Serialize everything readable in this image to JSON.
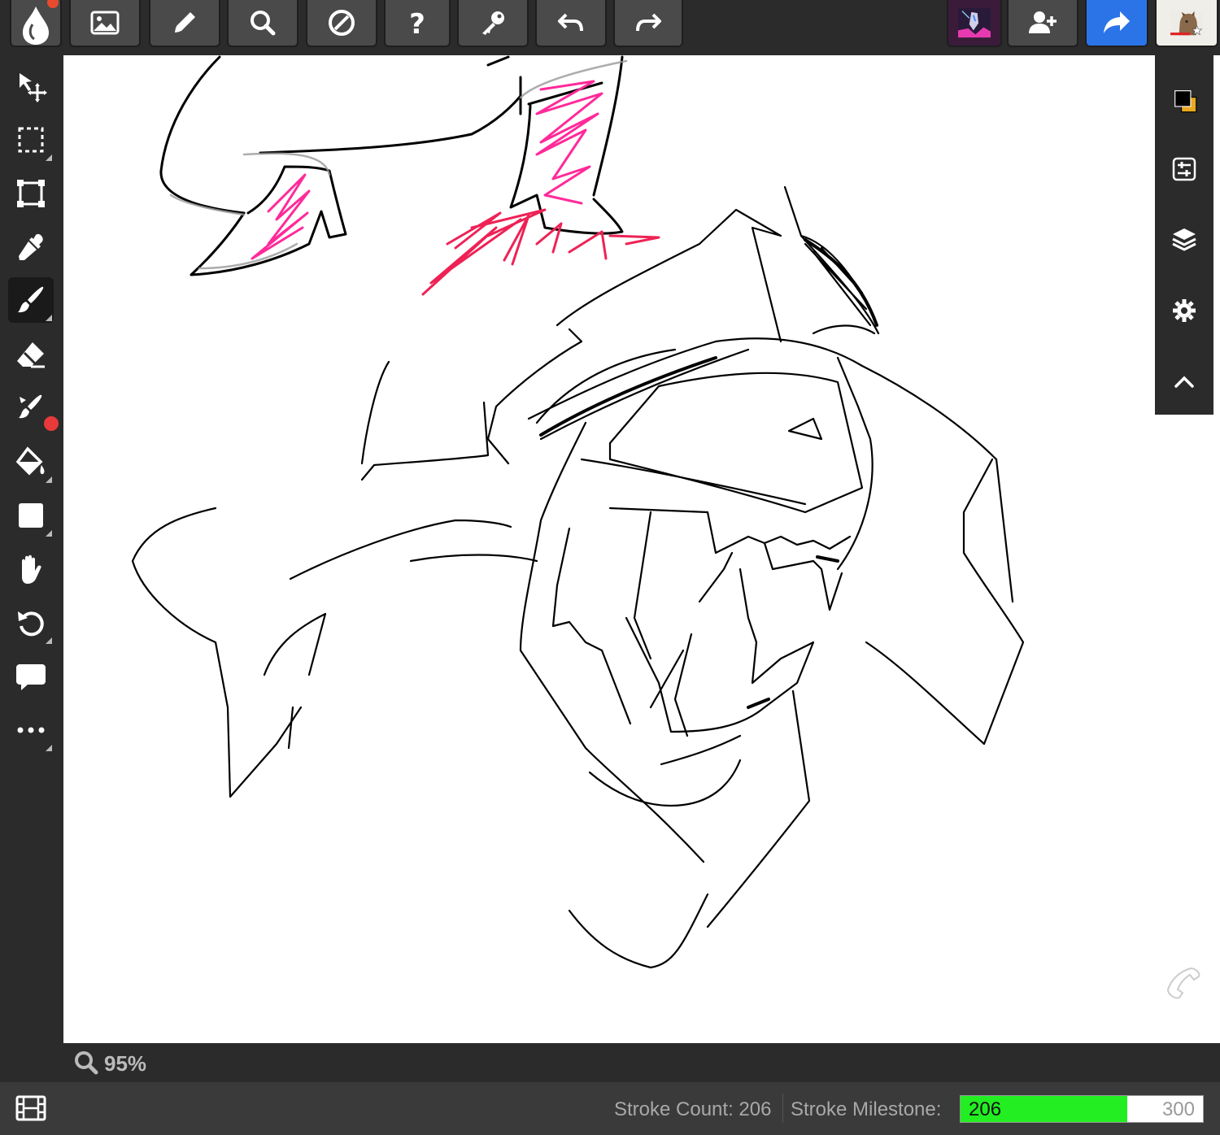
{
  "toolbar": {
    "buttons": [
      {
        "name": "image-button",
        "icon": "image-icon"
      },
      {
        "name": "pencil-button",
        "icon": "pencil-icon"
      },
      {
        "name": "search-button",
        "icon": "search-icon"
      },
      {
        "name": "no-button",
        "icon": "prohibited-icon"
      },
      {
        "name": "help-button",
        "icon": "question-icon"
      },
      {
        "name": "key-button",
        "icon": "key-icon"
      },
      {
        "name": "undo-button",
        "icon": "undo-icon"
      },
      {
        "name": "redo-button",
        "icon": "redo-icon"
      }
    ],
    "right": [
      "artwork-thumbnail",
      "add-user-button",
      "share-button",
      "user-avatar"
    ],
    "share_color": "#2a74e8"
  },
  "tools": [
    {
      "name": "move-tool",
      "icon": "move-icon"
    },
    {
      "name": "select-tool",
      "icon": "select-icon"
    },
    {
      "name": "transform-tool",
      "icon": "transform-icon"
    },
    {
      "name": "eyedropper-tool",
      "icon": "eyedropper-icon"
    },
    {
      "name": "brush-tool",
      "icon": "brush-icon",
      "active": true
    },
    {
      "name": "eraser-tool",
      "icon": "eraser-icon"
    },
    {
      "name": "brush-settings-tool",
      "icon": "brush-dot-icon"
    },
    {
      "name": "fill-tool",
      "icon": "paint-bucket-icon"
    },
    {
      "name": "shape-tool",
      "icon": "square-icon"
    },
    {
      "name": "hand-tool",
      "icon": "hand-icon"
    },
    {
      "name": "rotate-tool",
      "icon": "rotate-icon"
    },
    {
      "name": "comment-tool",
      "icon": "comment-icon"
    },
    {
      "name": "more-tool",
      "icon": "ellipsis-icon"
    }
  ],
  "colors": {
    "primary": "#000000",
    "secondary": "#e8a820",
    "brush_pink": "#ff2a9a",
    "brush_red": "#ee2255"
  },
  "right_panel": [
    "color-swatch",
    "adjustments-icon",
    "layers-icon",
    "gear-icon",
    "chevron-up-icon"
  ],
  "zoom": {
    "label": "95%"
  },
  "status": {
    "stroke_count": "Stroke Count: 206",
    "stroke_milestone": "Stroke Milestone:",
    "progress_value": "206",
    "progress_max": "300",
    "progress_fraction": 0.687
  }
}
